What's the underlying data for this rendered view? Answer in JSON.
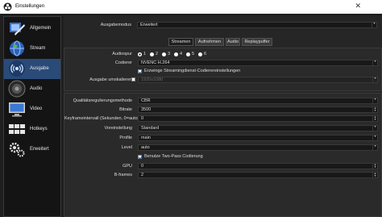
{
  "window": {
    "title": "Einstellungen"
  },
  "sidebar": {
    "items": [
      {
        "label": "Allgemein",
        "icon": "general-settings-icon"
      },
      {
        "label": "Stream",
        "icon": "globe-stream-icon"
      },
      {
        "label": "Ausgabe",
        "icon": "output-signal-icon",
        "active": true
      },
      {
        "label": "Audio",
        "icon": "speaker-icon"
      },
      {
        "label": "Video",
        "icon": "monitor-icon"
      },
      {
        "label": "Hotkeys",
        "icon": "keyboard-icon"
      },
      {
        "label": "Erweitert",
        "icon": "gears-icon"
      }
    ]
  },
  "output": {
    "mode_label": "Ausgabemodus",
    "mode_value": "Erweitert",
    "tabs": [
      "Streamen",
      "Aufnehmen",
      "Audio",
      "Replaypuffer"
    ],
    "audiospur_label": "Audiospur",
    "audio_tracks": [
      "1",
      "2",
      "3",
      "4",
      "5",
      "6"
    ],
    "encoder_label": "Codierer",
    "encoder_value": "NVENC H.264",
    "force_stream_label": "Erzwinge Streamingdienst-Codierereinstellungen",
    "rescale_label": "Ausgabe umskalieren",
    "rescale_value": "1920x1080"
  },
  "encoder": {
    "rate_control_label": "Qualitätsregulierungsmethode",
    "rate_control_value": "CBR",
    "bitrate_label": "Bitrate",
    "bitrate_value": "3500",
    "keyframe_label": "Keyframeintervall (Sekunden, 0=auto)",
    "keyframe_value": "0",
    "preset_label": "Voreinstellung",
    "preset_value": "Standard",
    "profile_label": "Profile",
    "profile_value": "main",
    "level_label": "Level",
    "level_value": "auto",
    "twopass_label": "Benutze Two-Pass Codierung",
    "gpu_label": "GPU",
    "gpu_value": "0",
    "bframes_label": "B-frames",
    "bframes_value": "2"
  },
  "colors": {
    "active_nav": "#2a4a78",
    "window_bg": "#1f1f1f"
  }
}
